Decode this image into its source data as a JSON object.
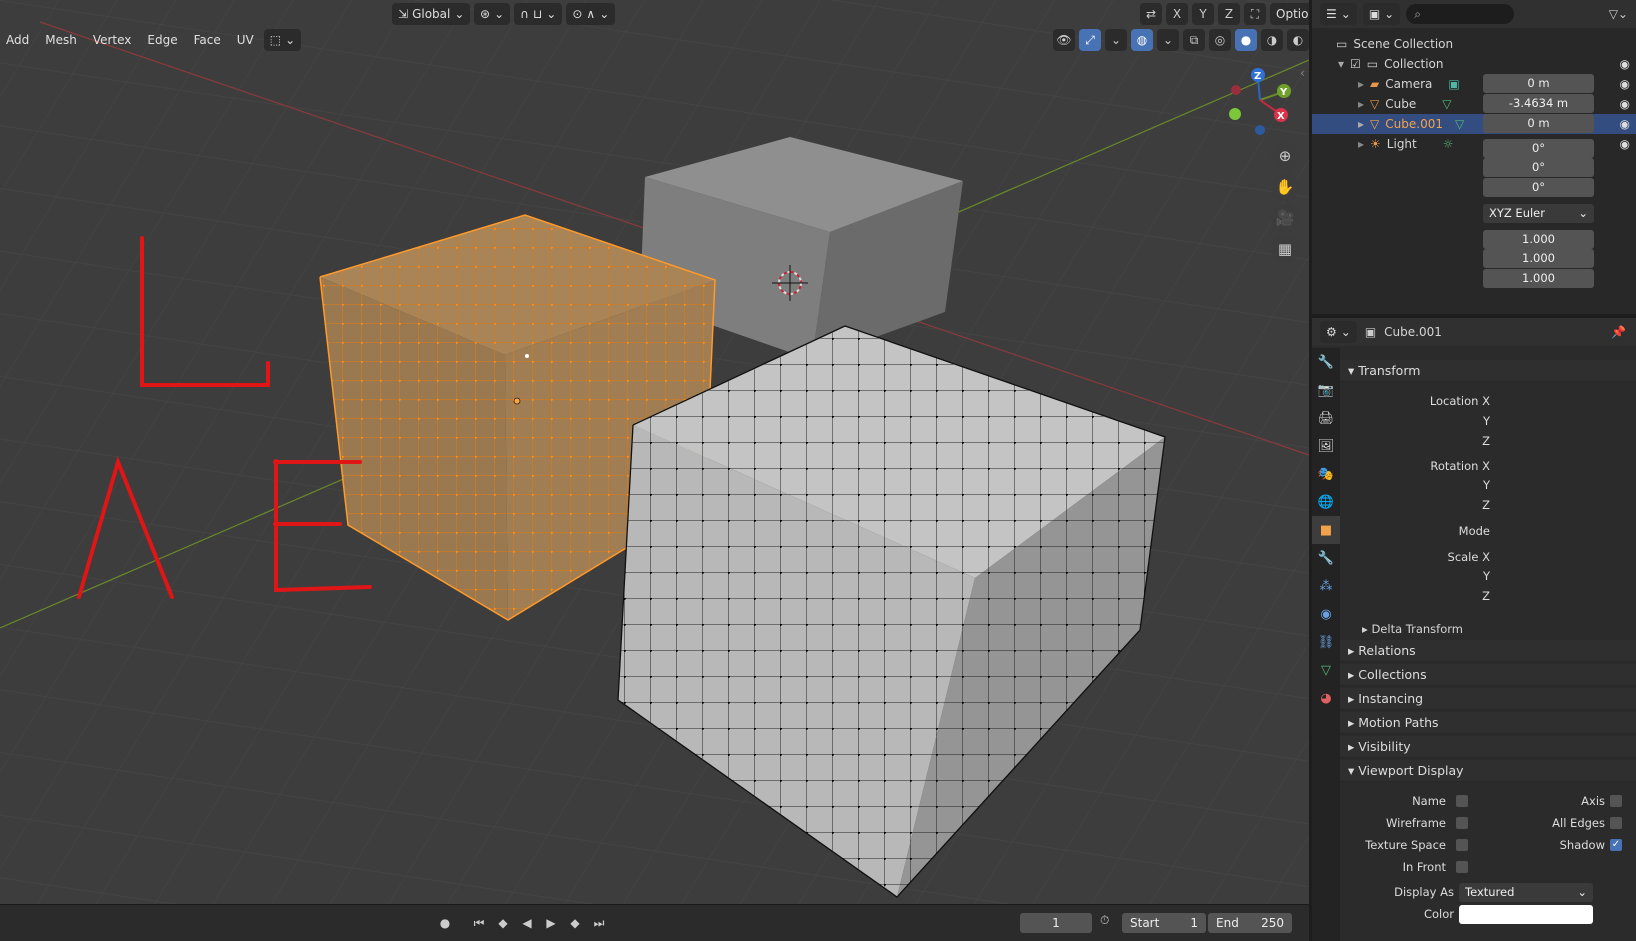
{
  "header": {
    "menus": [
      "Add",
      "Mesh",
      "Vertex",
      "Edge",
      "Face",
      "UV"
    ],
    "orientation": "Global",
    "axes": [
      "X",
      "Y",
      "Z"
    ],
    "options_label": "Options"
  },
  "annotations": [
    "L",
    "A",
    "E"
  ],
  "outliner": {
    "search_placeholder": "",
    "scene_collection": "Scene Collection",
    "collection": "Collection",
    "items": [
      {
        "name": "Camera",
        "selected": false
      },
      {
        "name": "Cube",
        "selected": false
      },
      {
        "name": "Cube.001",
        "selected": true
      },
      {
        "name": "Light",
        "selected": false
      }
    ]
  },
  "properties": {
    "object_name": "Cube.001",
    "transform_label": "Transform",
    "location": {
      "label": "Location X",
      "x": "0 m",
      "y": "-3.4634 m",
      "z": "0 m"
    },
    "rotation": {
      "label": "Rotation X",
      "x": "0°",
      "y": "0°",
      "z": "0°"
    },
    "mode_label": "Mode",
    "mode_value": "XYZ Euler",
    "scale": {
      "label": "Scale X",
      "x": "1.000",
      "y": "1.000",
      "z": "1.000"
    },
    "axis_y": "Y",
    "axis_z": "Z",
    "delta_transform": "Delta Transform",
    "sections": [
      "Relations",
      "Collections",
      "Instancing",
      "Motion Paths",
      "Visibility"
    ],
    "viewport_display": "Viewport Display",
    "vd": {
      "name": "Name",
      "axis": "Axis",
      "wireframe": "Wireframe",
      "all_edges": "All Edges",
      "texture_space": "Texture Space",
      "shadow": "Shadow",
      "in_front": "In Front",
      "display_as": "Display As",
      "display_as_value": "Textured",
      "color": "Color"
    }
  },
  "timeline": {
    "frame": "1",
    "start_label": "Start",
    "start": "1",
    "end_label": "End",
    "end": "250"
  },
  "colors": {
    "selected": "#4772b3",
    "orange": "#f28a1a",
    "bg": "#3d3d3d"
  }
}
